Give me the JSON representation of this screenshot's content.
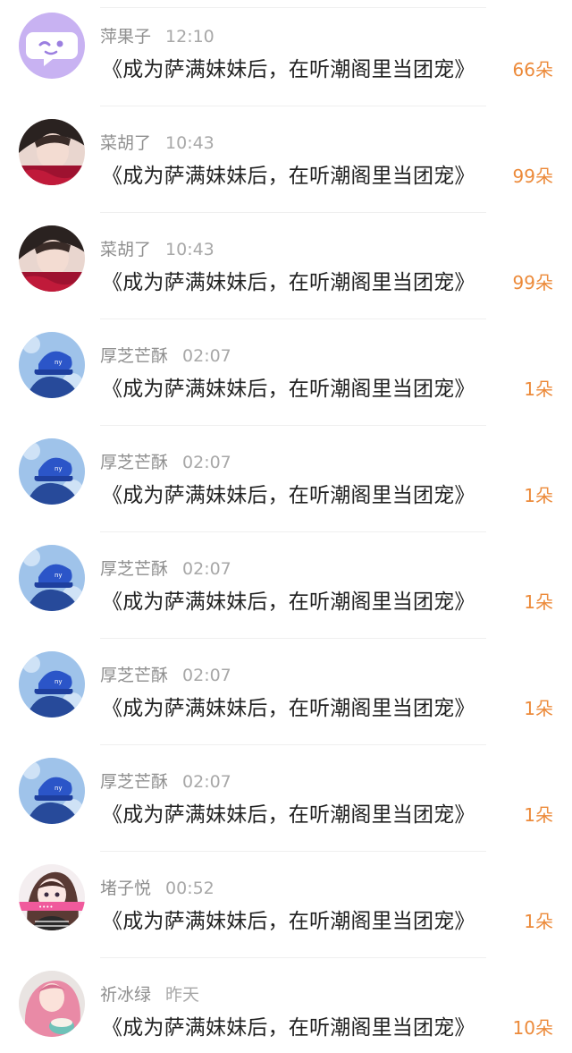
{
  "colors": {
    "count_accent": "#ec8a3a",
    "meta_text": "#8f8f8f",
    "title_text": "#222222"
  },
  "entries": [
    {
      "avatar": "smiley-bubble-avatar",
      "name": "萍果子",
      "time": "12:10",
      "title": "《成为萨满妹妹后，在听潮阁里当团宠》",
      "count": "66朵"
    },
    {
      "avatar": "male-portrait-avatar",
      "name": "菜胡了",
      "time": "10:43",
      "title": "《成为萨满妹妹后，在听潮阁里当团宠》",
      "count": "99朵"
    },
    {
      "avatar": "male-portrait-avatar",
      "name": "菜胡了",
      "time": "10:43",
      "title": "《成为萨满妹妹后，在听潮阁里当团宠》",
      "count": "99朵"
    },
    {
      "avatar": "blue-cap-avatar",
      "name": "厚芝芒酥",
      "time": "02:07",
      "title": "《成为萨满妹妹后，在听潮阁里当团宠》",
      "count": "1朵"
    },
    {
      "avatar": "blue-cap-avatar",
      "name": "厚芝芒酥",
      "time": "02:07",
      "title": "《成为萨满妹妹后，在听潮阁里当团宠》",
      "count": "1朵"
    },
    {
      "avatar": "blue-cap-avatar",
      "name": "厚芝芒酥",
      "time": "02:07",
      "title": "《成为萨满妹妹后，在听潮阁里当团宠》",
      "count": "1朵"
    },
    {
      "avatar": "blue-cap-avatar",
      "name": "厚芝芒酥",
      "time": "02:07",
      "title": "《成为萨满妹妹后，在听潮阁里当团宠》",
      "count": "1朵"
    },
    {
      "avatar": "blue-cap-avatar",
      "name": "厚芝芒酥",
      "time": "02:07",
      "title": "《成为萨满妹妹后，在听潮阁里当团宠》",
      "count": "1朵"
    },
    {
      "avatar": "anime-girl-avatar",
      "name": "堵子悦",
      "time": "00:52",
      "title": "《成为萨满妹妹后，在听潮阁里当团宠》",
      "count": "1朵"
    },
    {
      "avatar": "pink-hair-girl-avatar",
      "name": "祈冰绿",
      "time": "昨天",
      "title": "《成为萨满妹妹后，在听潮阁里当团宠》",
      "count": "10朵"
    }
  ]
}
